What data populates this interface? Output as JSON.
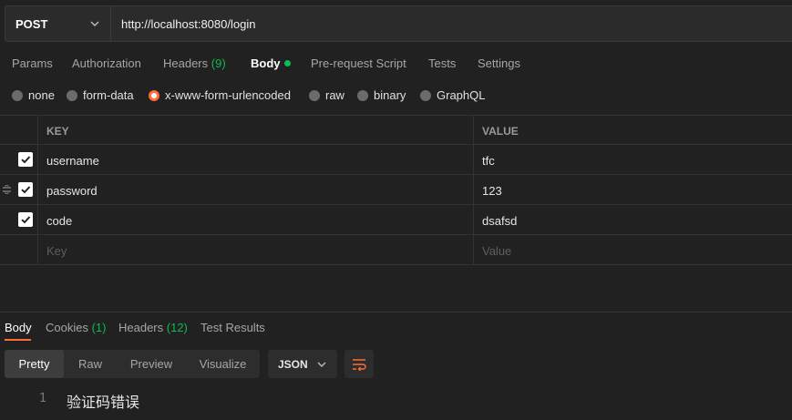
{
  "request": {
    "method": "POST",
    "url": "http://localhost:8080/login"
  },
  "tabs": {
    "params": "Params",
    "authorization": "Authorization",
    "headers_label": "Headers",
    "headers_count": "(9)",
    "body": "Body",
    "prerequest": "Pre-request Script",
    "tests": "Tests",
    "settings": "Settings"
  },
  "body_types": {
    "none": "none",
    "form_data": "form-data",
    "urlencoded": "x-www-form-urlencoded",
    "raw": "raw",
    "binary": "binary",
    "graphql": "GraphQL",
    "selected": "x-www-form-urlencoded"
  },
  "params_table": {
    "header_key": "KEY",
    "header_value": "VALUE",
    "rows": [
      {
        "key": "username",
        "value": "tfc",
        "checked": true
      },
      {
        "key": "password",
        "value": "123",
        "checked": true
      },
      {
        "key": "code",
        "value": "dsafsd",
        "checked": true
      }
    ],
    "placeholder_key": "Key",
    "placeholder_value": "Value"
  },
  "response": {
    "tabs": {
      "body": "Body",
      "cookies_label": "Cookies",
      "cookies_count": "(1)",
      "headers_label": "Headers",
      "headers_count": "(12)",
      "test_results": "Test Results"
    },
    "view_modes": {
      "pretty": "Pretty",
      "raw": "Raw",
      "preview": "Preview",
      "visualize": "Visualize"
    },
    "format": "JSON",
    "lines": [
      {
        "number": "1",
        "text": "验证码错误"
      }
    ]
  },
  "colors": {
    "accent": "#ff6c37",
    "status_green": "#0cbb52",
    "background": "#212121"
  }
}
